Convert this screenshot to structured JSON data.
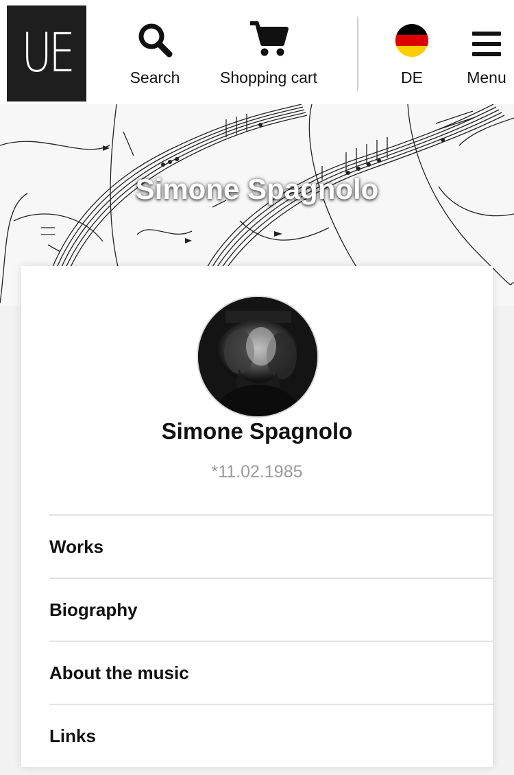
{
  "header": {
    "logo_text": "UE",
    "search_label": "Search",
    "cart_label": "Shopping cart",
    "language_label": "DE",
    "menu_label": "Menu"
  },
  "hero": {
    "title": "Simone Spagnolo"
  },
  "profile": {
    "name": "Simone Spagnolo",
    "birth": "*11.02.1985"
  },
  "nav": {
    "items": [
      {
        "label": "Works"
      },
      {
        "label": "Biography"
      },
      {
        "label": "About the music"
      },
      {
        "label": "Links"
      }
    ]
  },
  "icons": {
    "search": "search-icon",
    "cart": "shopping-cart-icon",
    "language": "german-flag-icon",
    "menu": "hamburger-menu-icon"
  },
  "colors": {
    "logo_bg": "#1e1e1e",
    "flag_black": "#000000",
    "flag_red": "#dd0000",
    "flag_gold": "#ffce00",
    "muted_text": "#9a9a9a"
  }
}
